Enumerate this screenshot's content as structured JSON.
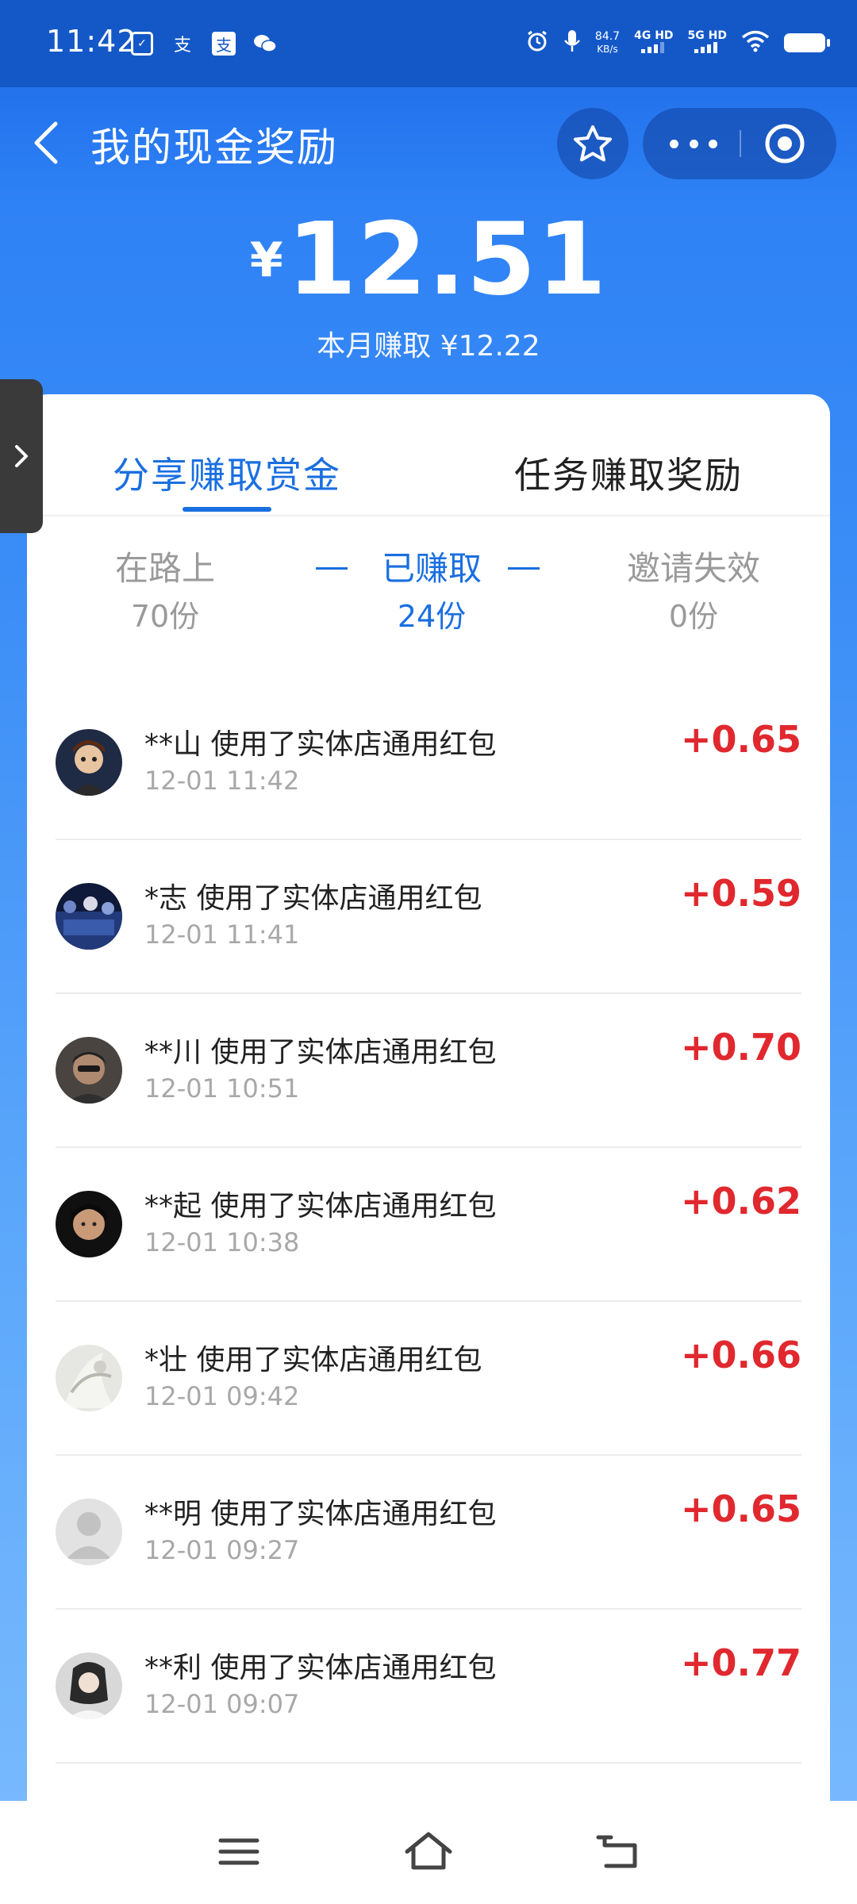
{
  "status_bar": {
    "time": "11:42",
    "net_speed_value": "84.7",
    "net_speed_unit": "KB/s",
    "sim1": "4G HD",
    "sim2": "5G HD",
    "icons": [
      "doc-check-icon",
      "alipay-icon",
      "alipay-icon",
      "wechat-icon",
      "alarm-icon",
      "mic-icon",
      "wifi-icon",
      "battery-icon"
    ]
  },
  "header": {
    "title": "我的现金奖励"
  },
  "balance": {
    "currency": "¥",
    "amount": "12.51",
    "month_earned": "本月赚取 ¥12.22"
  },
  "tabs": {
    "share": "分享赚取赏金",
    "task": "任务赚取奖励"
  },
  "subtabs": {
    "on_the_way": {
      "label": "在路上",
      "count": "70份"
    },
    "earned": {
      "label": "已赚取",
      "count": "24份"
    },
    "invalid": {
      "label": "邀请失效",
      "count": "0份"
    }
  },
  "colors": {
    "accent": "#1a6fe0",
    "amount": "#e0282e",
    "header_bg": "#2f82f5"
  },
  "records": [
    {
      "user": "**山",
      "action": "使用了实体店通用红包",
      "time": "12-01 11:42",
      "amount": "+0.65"
    },
    {
      "user": "*志",
      "action": "使用了实体店通用红包",
      "time": "12-01 11:41",
      "amount": "+0.59"
    },
    {
      "user": "**川",
      "action": "使用了实体店通用红包",
      "time": "12-01 10:51",
      "amount": "+0.70"
    },
    {
      "user": "**起",
      "action": "使用了实体店通用红包",
      "time": "12-01 10:38",
      "amount": "+0.62"
    },
    {
      "user": "*壮",
      "action": "使用了实体店通用红包",
      "time": "12-01 09:42",
      "amount": "+0.66"
    },
    {
      "user": "**明",
      "action": "使用了实体店通用红包",
      "time": "12-01 09:27",
      "amount": "+0.65"
    },
    {
      "user": "**利",
      "action": "使用了实体店通用红包",
      "time": "12-01 09:07",
      "amount": "+0.77"
    }
  ]
}
